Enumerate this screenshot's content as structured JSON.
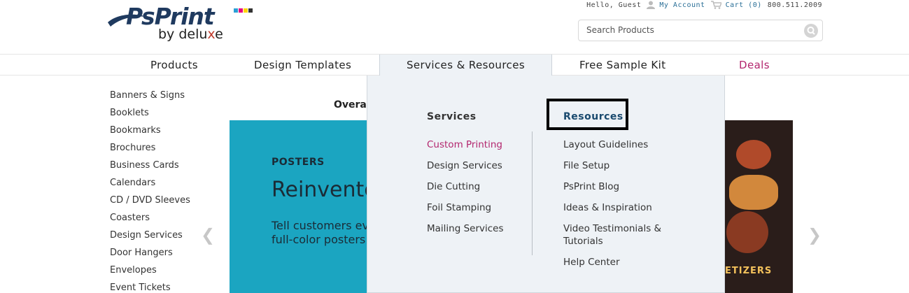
{
  "brand": {
    "name": "PsPrint",
    "sub_prefix": "by delu",
    "sub_x": "x",
    "sub_suffix": "e",
    "colors": [
      "#2b9fd6",
      "#e6007e",
      "#ffd400",
      "#333333"
    ]
  },
  "top_bar": {
    "greeting": "Hello, Guest",
    "account": "My Account",
    "cart": "Cart (0)",
    "phone": "800.511.2009"
  },
  "search": {
    "placeholder": "Search Products"
  },
  "nav": {
    "items": [
      "Products",
      "Design Templates",
      "Services & Resources",
      "Free Sample Kit",
      "Deals"
    ],
    "active": "Services & Resources"
  },
  "sidebar": {
    "items": [
      "Banners & Signs",
      "Booklets",
      "Bookmarks",
      "Brochures",
      "Business Cards",
      "Calendars",
      "CD / DVD Sleeves",
      "Coasters",
      "Design Services",
      "Door Hangers",
      "Envelopes",
      "Event Tickets"
    ]
  },
  "hero": {
    "heading_partial": "Overall",
    "kicker": "POSTERS",
    "headline": "Reinvente",
    "body_line1": "Tell customers ev",
    "body_line2": "full-color posters",
    "photo_sign": "ETIZERS",
    "bg_color": "#1ba5c1"
  },
  "mega_menu": {
    "services_head": "Services",
    "services": [
      "Custom Printing",
      "Design Services",
      "Die Cutting",
      "Foil Stamping",
      "Mailing Services"
    ],
    "services_highlight": "Custom Printing",
    "resources_head": "Resources",
    "resources": [
      "Layout Guidelines",
      "File Setup",
      "PsPrint Blog",
      "Ideas & Inspiration",
      "Video Testimonials &",
      "Tutorials",
      "Help Center"
    ]
  },
  "icons": {
    "user": "user-icon",
    "cart": "cart-icon",
    "search": "search-icon",
    "prev": "chevron-left-icon",
    "next": "chevron-right-icon"
  },
  "accent_colors": {
    "deals": "#b3266e",
    "link": "#2a6f97"
  }
}
